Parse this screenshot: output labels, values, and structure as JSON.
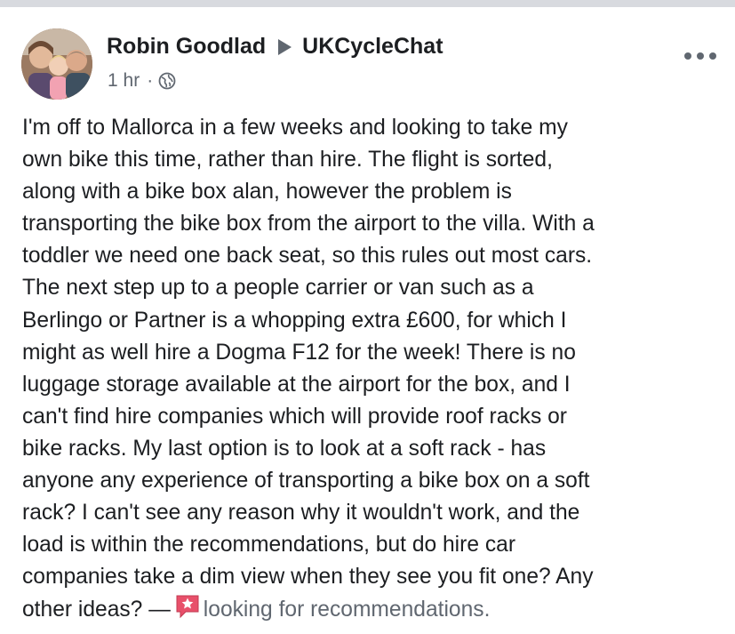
{
  "post": {
    "author": "Robin Goodlad",
    "group": "UKCycleChat",
    "timestamp": "1 hr",
    "separator": "·",
    "privacy_icon": "globe-icon",
    "more_icon": "more-options-icon",
    "body_lines": [
      "I'm off to Mallorca in a few weeks and looking to take my",
      "own bike this time, rather than hire. The flight is sorted,",
      "along with a bike box alan, however the problem is",
      "transporting the bike box from the airport to the villa. With a",
      "toddler we need one back seat, so this rules out most cars.",
      "The next step up to a people carrier or van such as a",
      "Berlingo or Partner is a whopping extra £600, for which I",
      "might as well hire a Dogma F12 for the week! There is no",
      "luggage storage available at the airport for the box, and I",
      "can't find hire companies which will provide roof racks or",
      "bike racks. My last option is to look at a soft rack - has",
      "anyone any experience of transporting a bike box on a soft",
      "rack? I can't see any reason why it wouldn't work, and the",
      "load is within the recommendations, but do hire car",
      "companies take a dim view when they see you fit one? Any"
    ],
    "last_line_prefix": "other ideas? —",
    "feeling_icon": "recommendation-star-icon",
    "feeling_text": "looking for recommendations."
  },
  "colors": {
    "text": "#1c1e21",
    "secondary": "#606770",
    "divider": "#d8dadf",
    "feeling_badge": "#e8506a"
  }
}
